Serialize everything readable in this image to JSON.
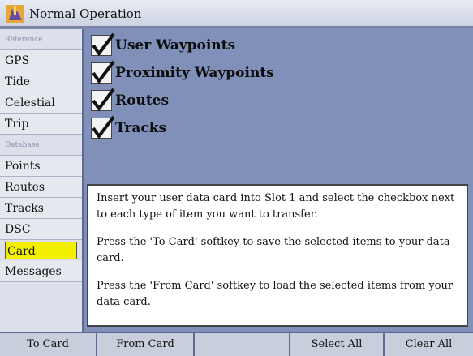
{
  "title": "Normal Operation",
  "sidebar": {
    "items": [
      {
        "label": "Reference",
        "type": "header"
      },
      {
        "label": "GPS"
      },
      {
        "label": "Tide"
      },
      {
        "label": "Celestial"
      },
      {
        "label": "Trip"
      },
      {
        "label": "Database",
        "type": "header"
      },
      {
        "label": "Points"
      },
      {
        "label": "Routes"
      },
      {
        "label": "Tracks"
      },
      {
        "label": "DSC"
      },
      {
        "label": "Card",
        "selected": true
      },
      {
        "label": "Messages"
      }
    ]
  },
  "checkboxes": [
    {
      "label": "User Waypoints",
      "checked": true
    },
    {
      "label": "Proximity Waypoints",
      "checked": true
    },
    {
      "label": "Routes",
      "checked": true
    },
    {
      "label": "Tracks",
      "checked": true
    }
  ],
  "info": {
    "p1": "Insert your user data card into Slot 1 and select the checkbox next to each type of item you want to transfer.",
    "p2": "Press the 'To Card' softkey to save the selected items to your data card.",
    "p3": "Press the 'From Card' softkey to load the selected items from your data card."
  },
  "softkeys": {
    "k1": "To Card",
    "k2": "From Card",
    "k3": "",
    "k4": "Select All",
    "k5": "Clear All"
  },
  "colors": {
    "selected": "#f2ef00",
    "accent": "#8090b8"
  }
}
